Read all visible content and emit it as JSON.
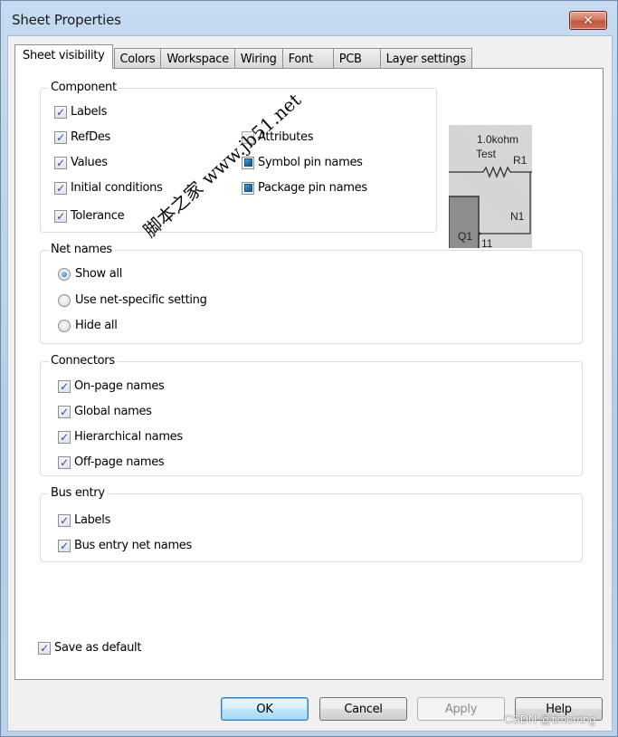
{
  "window": {
    "title": "Sheet Properties",
    "close_icon": "close-icon"
  },
  "tabs": [
    {
      "label": "Sheet visibility",
      "active": true
    },
    {
      "label": "Colors",
      "active": false
    },
    {
      "label": "Workspace",
      "active": false
    },
    {
      "label": "Wiring",
      "active": false
    },
    {
      "label": "Font",
      "active": false
    },
    {
      "label": "PCB",
      "active": false
    },
    {
      "label": "Layer settings",
      "active": false
    }
  ],
  "component": {
    "title": "Component",
    "options": [
      {
        "label": "Labels",
        "state": "checked"
      },
      {
        "label": "RefDes",
        "state": "checked"
      },
      {
        "label": "Values",
        "state": "checked"
      },
      {
        "label": "Initial conditions",
        "state": "checked"
      },
      {
        "label": "Tolerance",
        "state": "checked"
      },
      {
        "label": "Attributes",
        "state": "unchecked"
      },
      {
        "label": "Symbol pin names",
        "state": "indeterminate"
      },
      {
        "label": "Package pin names",
        "state": "indeterminate"
      }
    ]
  },
  "preview": {
    "value_label": "1.0kohm",
    "tolerance_label": "Test",
    "refdes_label": "R1",
    "net_label": "N1",
    "component_label": "Q1",
    "pin_label": "11"
  },
  "net_names": {
    "title": "Net names",
    "options": [
      {
        "label": "Show all",
        "selected": true
      },
      {
        "label": "Use net-specific setting",
        "selected": false
      },
      {
        "label": "Hide all",
        "selected": false
      }
    ]
  },
  "connectors": {
    "title": "Connectors",
    "options": [
      {
        "label": "On-page names",
        "state": "checked"
      },
      {
        "label": "Global names",
        "state": "checked"
      },
      {
        "label": "Hierarchical names",
        "state": "checked"
      },
      {
        "label": "Off-page names",
        "state": "checked"
      }
    ]
  },
  "bus_entry": {
    "title": "Bus entry",
    "options": [
      {
        "label": "Labels",
        "state": "checked"
      },
      {
        "label": "Bus entry net names",
        "state": "checked"
      }
    ]
  },
  "save_default": {
    "label": "Save as default",
    "state": "checked"
  },
  "buttons": {
    "ok": "OK",
    "cancel": "Cancel",
    "apply": "Apply",
    "help": "Help"
  },
  "watermarks": {
    "jb51": "脚本之家 www.jb51.net",
    "csdn": "CSDN @timerring"
  },
  "glyphs": {
    "check": "✓",
    "close": "✕"
  }
}
